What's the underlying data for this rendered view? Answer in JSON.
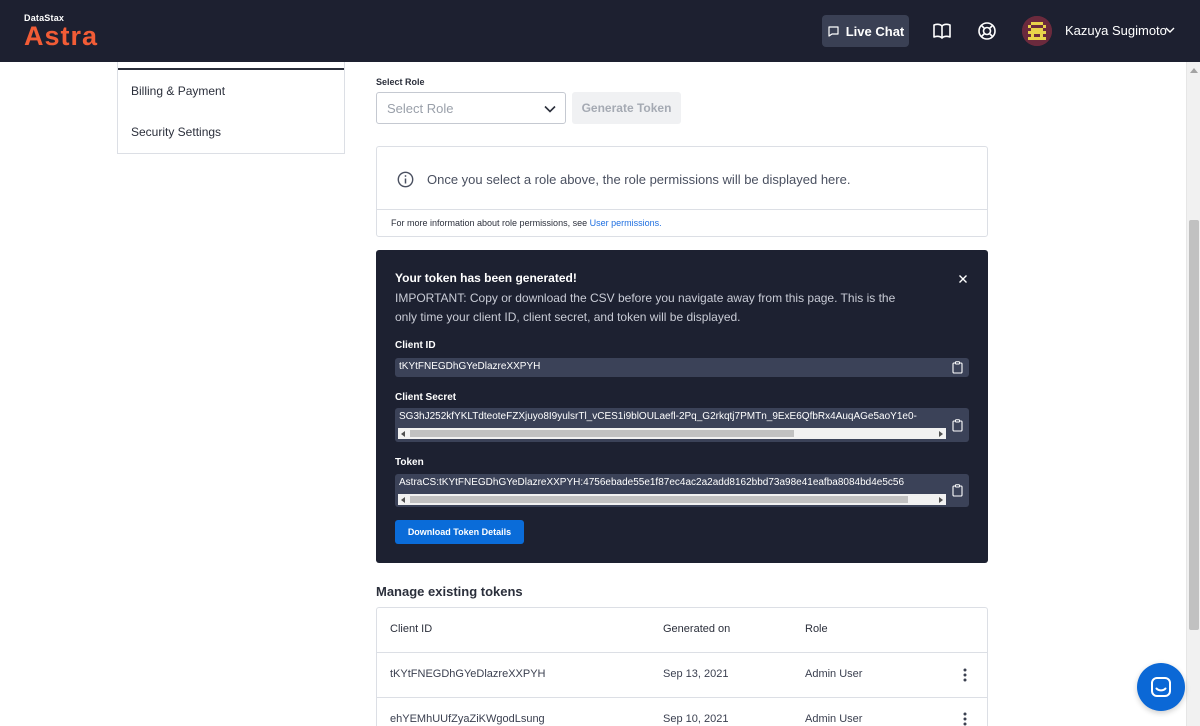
{
  "header": {
    "brand_small": "DataStax",
    "brand_big": "Astra",
    "live_chat": "Live Chat",
    "user_name": "Kazuya Sugimoto",
    "icons": [
      "book-icon",
      "help-icon",
      "chevron-down-icon"
    ]
  },
  "sidebar": {
    "items": [
      {
        "label": "Billing & Payment"
      },
      {
        "label": "Security Settings"
      }
    ]
  },
  "role": {
    "label": "Select Role",
    "placeholder": "Select Role",
    "generate_button": "Generate Token"
  },
  "info": {
    "message": "Once you select a role above, the role permissions will be displayed here.",
    "more_prefix": "For more information about role permissions, see ",
    "more_link": "User permissions."
  },
  "token": {
    "title": "Your token has been generated!",
    "message": "IMPORTANT: Copy or download the CSV before you navigate away from this page. This is the only time your client ID, client secret, and token will be displayed.",
    "client_id_label": "Client ID",
    "client_id_value": "tKYtFNEGDhGYeDlazreXXPYH",
    "client_secret_label": "Client Secret",
    "client_secret_value": "SG3hJ252kfYKLTdteoteFZXjuyo8I9yulsrTl_vCES1i9blOULaefl-2Pq_G2rkqtj7PMTn_9ExE6QfbRx4AuqAGe5aoY1e0-",
    "token_label": "Token",
    "token_value": "AstraCS:tKYtFNEGDhGYeDlazreXXPYH:4756ebade55e1f87ec4ac2a2add8162bbd73a98e41eafba8084bd4e5c56",
    "download_button": "Download Token Details"
  },
  "manage": {
    "title": "Manage existing tokens",
    "columns": [
      "Client ID",
      "Generated on",
      "Role"
    ],
    "rows": [
      {
        "client_id": "tKYtFNEGDhGYeDlazreXXPYH",
        "generated_on": "Sep 13, 2021",
        "role": "Admin User"
      },
      {
        "client_id": "ehYEMhUUfZyaZiKWgodLsung",
        "generated_on": "Sep 10, 2021",
        "role": "Admin User"
      }
    ]
  },
  "colors": {
    "header_bg": "#1d2030",
    "brand_accent": "#f25c36",
    "panel_bg": "#1d2131",
    "primary_blue": "#0a6cd9"
  }
}
